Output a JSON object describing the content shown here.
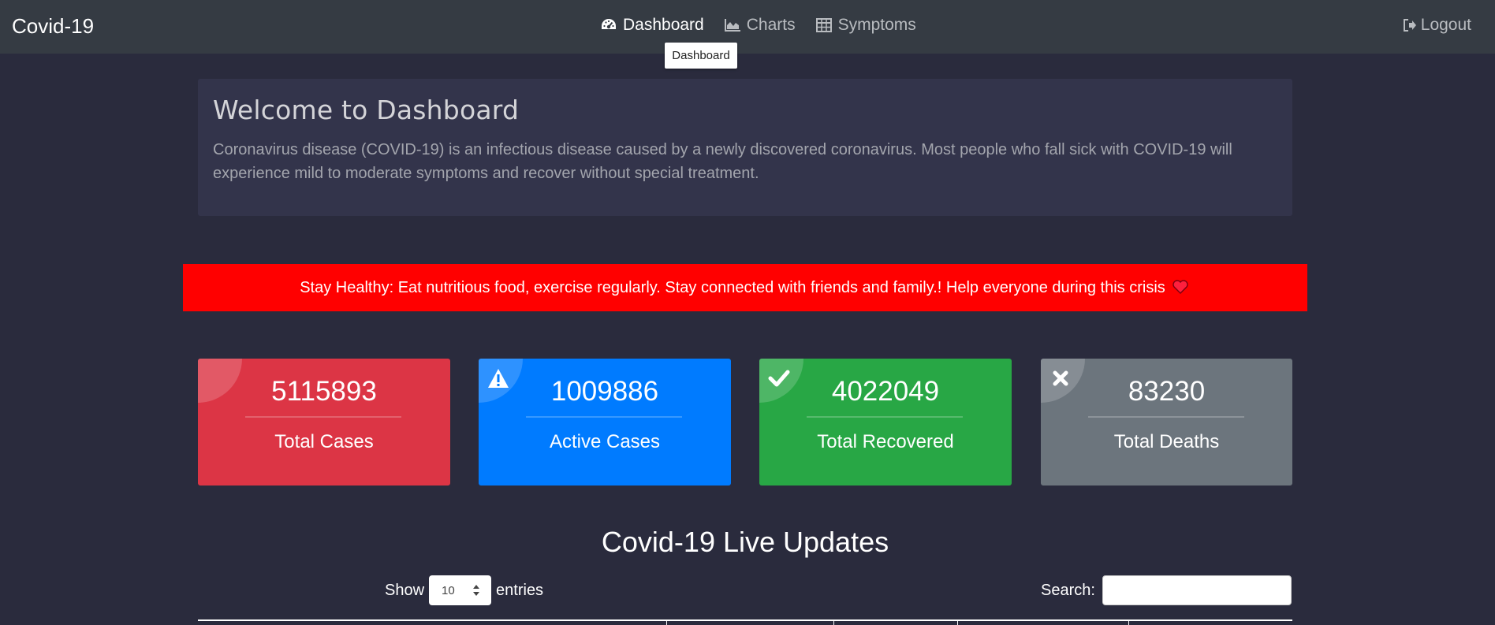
{
  "navbar": {
    "brand": "Covid-19",
    "items": [
      {
        "label": "Dashboard",
        "icon": "dashboard-icon",
        "active": true
      },
      {
        "label": "Charts",
        "icon": "area-chart-icon",
        "active": false
      },
      {
        "label": "Symptoms",
        "icon": "table-icon",
        "active": false
      }
    ],
    "logout": {
      "label": "Logout",
      "icon": "sign-out-icon"
    }
  },
  "tooltip": {
    "text": "Dashboard"
  },
  "jumbotron": {
    "title": "Welcome to Dashboard",
    "description": "Coronavirus disease (COVID-19) is an infectious disease caused by a newly discovered coronavirus. Most people who fall sick with COVID-19 will experience mild to moderate symptoms and recover without special treatment."
  },
  "alert": {
    "text": "Stay Healthy: Eat nutritious food, exercise regularly. Stay connected with friends and family.! Help everyone during this crisis",
    "icon": "heart-icon"
  },
  "stats": [
    {
      "value": "5115893",
      "label": "Total Cases",
      "color": "#dc3545",
      "icon": "none"
    },
    {
      "value": "1009886",
      "label": "Active Cases",
      "color": "#007bff",
      "icon": "warning-icon"
    },
    {
      "value": "4022049",
      "label": "Total Recovered",
      "color": "#28a745",
      "icon": "check-icon"
    },
    {
      "value": "83230",
      "label": "Total Deaths",
      "color": "#6c757d",
      "icon": "close-icon"
    }
  ],
  "live_updates": {
    "title": "Covid-19 Live Updates",
    "show_label": "Show",
    "entries_value": "10",
    "entries_label": "entries",
    "search_label": "Search:",
    "search_value": ""
  }
}
